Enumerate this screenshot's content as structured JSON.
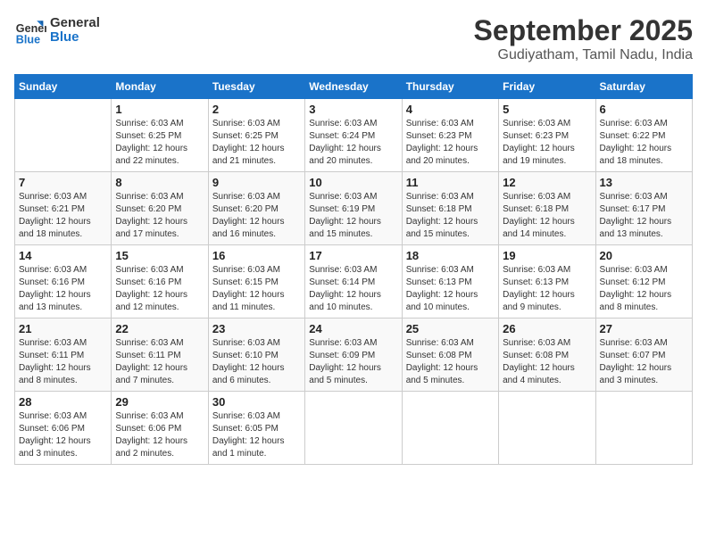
{
  "logo": {
    "line1": "General",
    "line2": "Blue"
  },
  "title": "September 2025",
  "subtitle": "Gudiyatham, Tamil Nadu, India",
  "days_of_week": [
    "Sunday",
    "Monday",
    "Tuesday",
    "Wednesday",
    "Thursday",
    "Friday",
    "Saturday"
  ],
  "weeks": [
    [
      {
        "day": "",
        "info": ""
      },
      {
        "day": "1",
        "info": "Sunrise: 6:03 AM\nSunset: 6:25 PM\nDaylight: 12 hours\nand 22 minutes."
      },
      {
        "day": "2",
        "info": "Sunrise: 6:03 AM\nSunset: 6:25 PM\nDaylight: 12 hours\nand 21 minutes."
      },
      {
        "day": "3",
        "info": "Sunrise: 6:03 AM\nSunset: 6:24 PM\nDaylight: 12 hours\nand 20 minutes."
      },
      {
        "day": "4",
        "info": "Sunrise: 6:03 AM\nSunset: 6:23 PM\nDaylight: 12 hours\nand 20 minutes."
      },
      {
        "day": "5",
        "info": "Sunrise: 6:03 AM\nSunset: 6:23 PM\nDaylight: 12 hours\nand 19 minutes."
      },
      {
        "day": "6",
        "info": "Sunrise: 6:03 AM\nSunset: 6:22 PM\nDaylight: 12 hours\nand 18 minutes."
      }
    ],
    [
      {
        "day": "7",
        "info": "Sunrise: 6:03 AM\nSunset: 6:21 PM\nDaylight: 12 hours\nand 18 minutes."
      },
      {
        "day": "8",
        "info": "Sunrise: 6:03 AM\nSunset: 6:20 PM\nDaylight: 12 hours\nand 17 minutes."
      },
      {
        "day": "9",
        "info": "Sunrise: 6:03 AM\nSunset: 6:20 PM\nDaylight: 12 hours\nand 16 minutes."
      },
      {
        "day": "10",
        "info": "Sunrise: 6:03 AM\nSunset: 6:19 PM\nDaylight: 12 hours\nand 15 minutes."
      },
      {
        "day": "11",
        "info": "Sunrise: 6:03 AM\nSunset: 6:18 PM\nDaylight: 12 hours\nand 15 minutes."
      },
      {
        "day": "12",
        "info": "Sunrise: 6:03 AM\nSunset: 6:18 PM\nDaylight: 12 hours\nand 14 minutes."
      },
      {
        "day": "13",
        "info": "Sunrise: 6:03 AM\nSunset: 6:17 PM\nDaylight: 12 hours\nand 13 minutes."
      }
    ],
    [
      {
        "day": "14",
        "info": "Sunrise: 6:03 AM\nSunset: 6:16 PM\nDaylight: 12 hours\nand 13 minutes."
      },
      {
        "day": "15",
        "info": "Sunrise: 6:03 AM\nSunset: 6:16 PM\nDaylight: 12 hours\nand 12 minutes."
      },
      {
        "day": "16",
        "info": "Sunrise: 6:03 AM\nSunset: 6:15 PM\nDaylight: 12 hours\nand 11 minutes."
      },
      {
        "day": "17",
        "info": "Sunrise: 6:03 AM\nSunset: 6:14 PM\nDaylight: 12 hours\nand 10 minutes."
      },
      {
        "day": "18",
        "info": "Sunrise: 6:03 AM\nSunset: 6:13 PM\nDaylight: 12 hours\nand 10 minutes."
      },
      {
        "day": "19",
        "info": "Sunrise: 6:03 AM\nSunset: 6:13 PM\nDaylight: 12 hours\nand 9 minutes."
      },
      {
        "day": "20",
        "info": "Sunrise: 6:03 AM\nSunset: 6:12 PM\nDaylight: 12 hours\nand 8 minutes."
      }
    ],
    [
      {
        "day": "21",
        "info": "Sunrise: 6:03 AM\nSunset: 6:11 PM\nDaylight: 12 hours\nand 8 minutes."
      },
      {
        "day": "22",
        "info": "Sunrise: 6:03 AM\nSunset: 6:11 PM\nDaylight: 12 hours\nand 7 minutes."
      },
      {
        "day": "23",
        "info": "Sunrise: 6:03 AM\nSunset: 6:10 PM\nDaylight: 12 hours\nand 6 minutes."
      },
      {
        "day": "24",
        "info": "Sunrise: 6:03 AM\nSunset: 6:09 PM\nDaylight: 12 hours\nand 5 minutes."
      },
      {
        "day": "25",
        "info": "Sunrise: 6:03 AM\nSunset: 6:08 PM\nDaylight: 12 hours\nand 5 minutes."
      },
      {
        "day": "26",
        "info": "Sunrise: 6:03 AM\nSunset: 6:08 PM\nDaylight: 12 hours\nand 4 minutes."
      },
      {
        "day": "27",
        "info": "Sunrise: 6:03 AM\nSunset: 6:07 PM\nDaylight: 12 hours\nand 3 minutes."
      }
    ],
    [
      {
        "day": "28",
        "info": "Sunrise: 6:03 AM\nSunset: 6:06 PM\nDaylight: 12 hours\nand 3 minutes."
      },
      {
        "day": "29",
        "info": "Sunrise: 6:03 AM\nSunset: 6:06 PM\nDaylight: 12 hours\nand 2 minutes."
      },
      {
        "day": "30",
        "info": "Sunrise: 6:03 AM\nSunset: 6:05 PM\nDaylight: 12 hours\nand 1 minute."
      },
      {
        "day": "",
        "info": ""
      },
      {
        "day": "",
        "info": ""
      },
      {
        "day": "",
        "info": ""
      },
      {
        "day": "",
        "info": ""
      }
    ]
  ]
}
